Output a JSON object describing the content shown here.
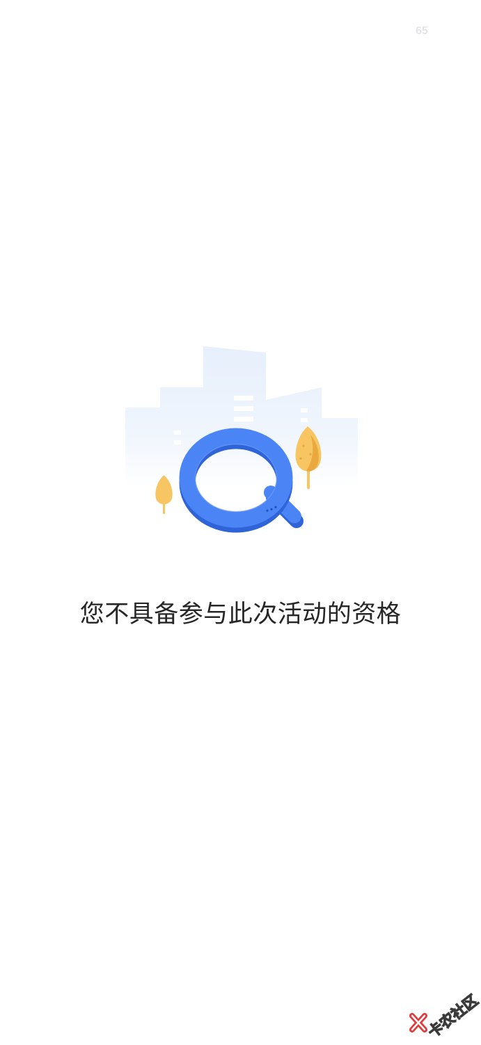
{
  "status": {
    "counter": "65"
  },
  "empty_state": {
    "illustration_icon": "magnifier-search-icon",
    "message": "您不具备参与此次活动的资格"
  },
  "watermark": {
    "text": "卡农社区",
    "icon": "red-x-logo-icon"
  },
  "colors": {
    "background": "#ffffff",
    "magnifier_blue": "#4a84f5",
    "tree_yellow": "#f7c561",
    "building_tint": "#e8f1fd",
    "message_text": "#262626"
  }
}
